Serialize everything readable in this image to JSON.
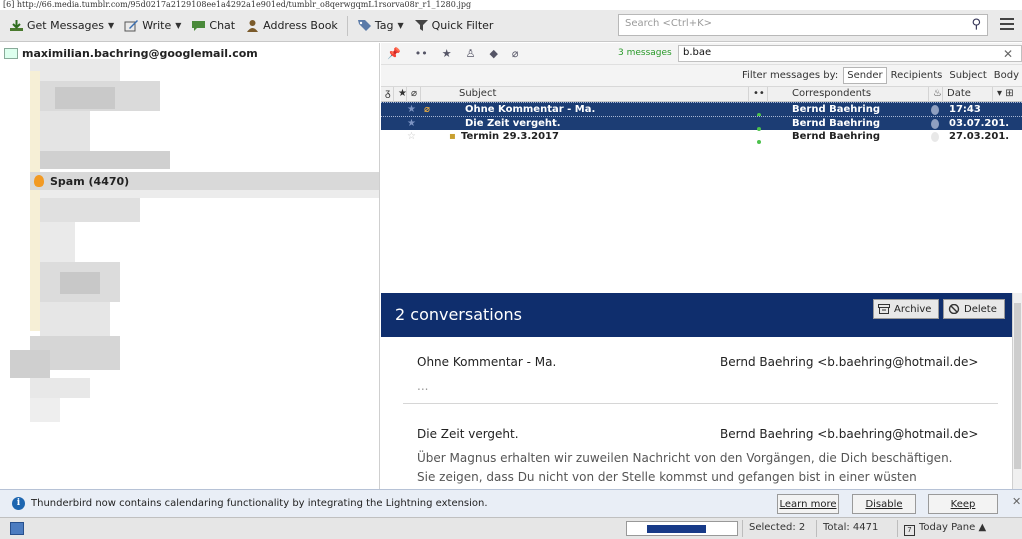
{
  "browser": {
    "url": "[6] http://66.media.tumblr.com/95d0217a2129108ee1a4292a1e901ed/tumblr_o8qerwgqmL1rsorva08r_r1_1280.jpg"
  },
  "toolbar": {
    "get_messages": "Get Messages",
    "write": "Write",
    "chat": "Chat",
    "address_book": "Address Book",
    "tag": "Tag",
    "quick_filter": "Quick Filter",
    "search_placeholder": "Search <Ctrl+K>"
  },
  "folders": {
    "account": "maximilian.bachring@googlemail.com",
    "spam_label": "Spam (4470)"
  },
  "quickfilter": {
    "count": "3 messages",
    "value": "b.bae",
    "filter_by_label": "Filter messages by:",
    "options": [
      "Sender",
      "Recipients",
      "Subject",
      "Body"
    ],
    "selected": "Sender"
  },
  "columns": {
    "subject": "Subject",
    "correspondents": "Correspondents",
    "date": "Date"
  },
  "messages": [
    {
      "subject": "Ohne Kommentar - Ma.",
      "correspondent": "Bernd Baehring",
      "date": "17:43",
      "selected": true
    },
    {
      "subject": "Die Zeit vergeht.",
      "correspondent": "Bernd Baehring",
      "date": "03.07.201...",
      "selected": true
    },
    {
      "subject": "Termin 29.3.2017",
      "correspondent": "Bernd Baehring",
      "date": "27.03.201...",
      "selected": false
    }
  ],
  "preview": {
    "title": "2 conversations",
    "archive": "Archive",
    "delete": "Delete",
    "items": [
      {
        "subject": "Ohne Kommentar - Ma.",
        "from": "Bernd Baehring <b.baehring@hotmail.de>",
        "snippet": "..."
      },
      {
        "subject": "Die Zeit vergeht.",
        "from": "Bernd Baehring <b.baehring@hotmail.de>",
        "snippet_1": "Über Magnus erhalten wir zuweilen Nachricht von den Vorgängen, die Dich beschäftigen.",
        "snippet_2": "Sie zeigen, dass Du nicht von der Stelle kommst und gefangen bist in einer wüsten"
      }
    ]
  },
  "notification": {
    "text": "Thunderbird now contains calendaring functionality by integrating the Lightning extension.",
    "learn_more": "Learn more",
    "disable": "Disable",
    "keep": "Keep"
  },
  "status": {
    "progress": 0.55,
    "selected": "Selected: 2",
    "total": "Total: 4471",
    "today_pane": "Today Pane"
  },
  "colors": {
    "selection": "#1c3d74",
    "conversation_header": "#0f2e6d",
    "spam_flame": "#f29a24"
  }
}
